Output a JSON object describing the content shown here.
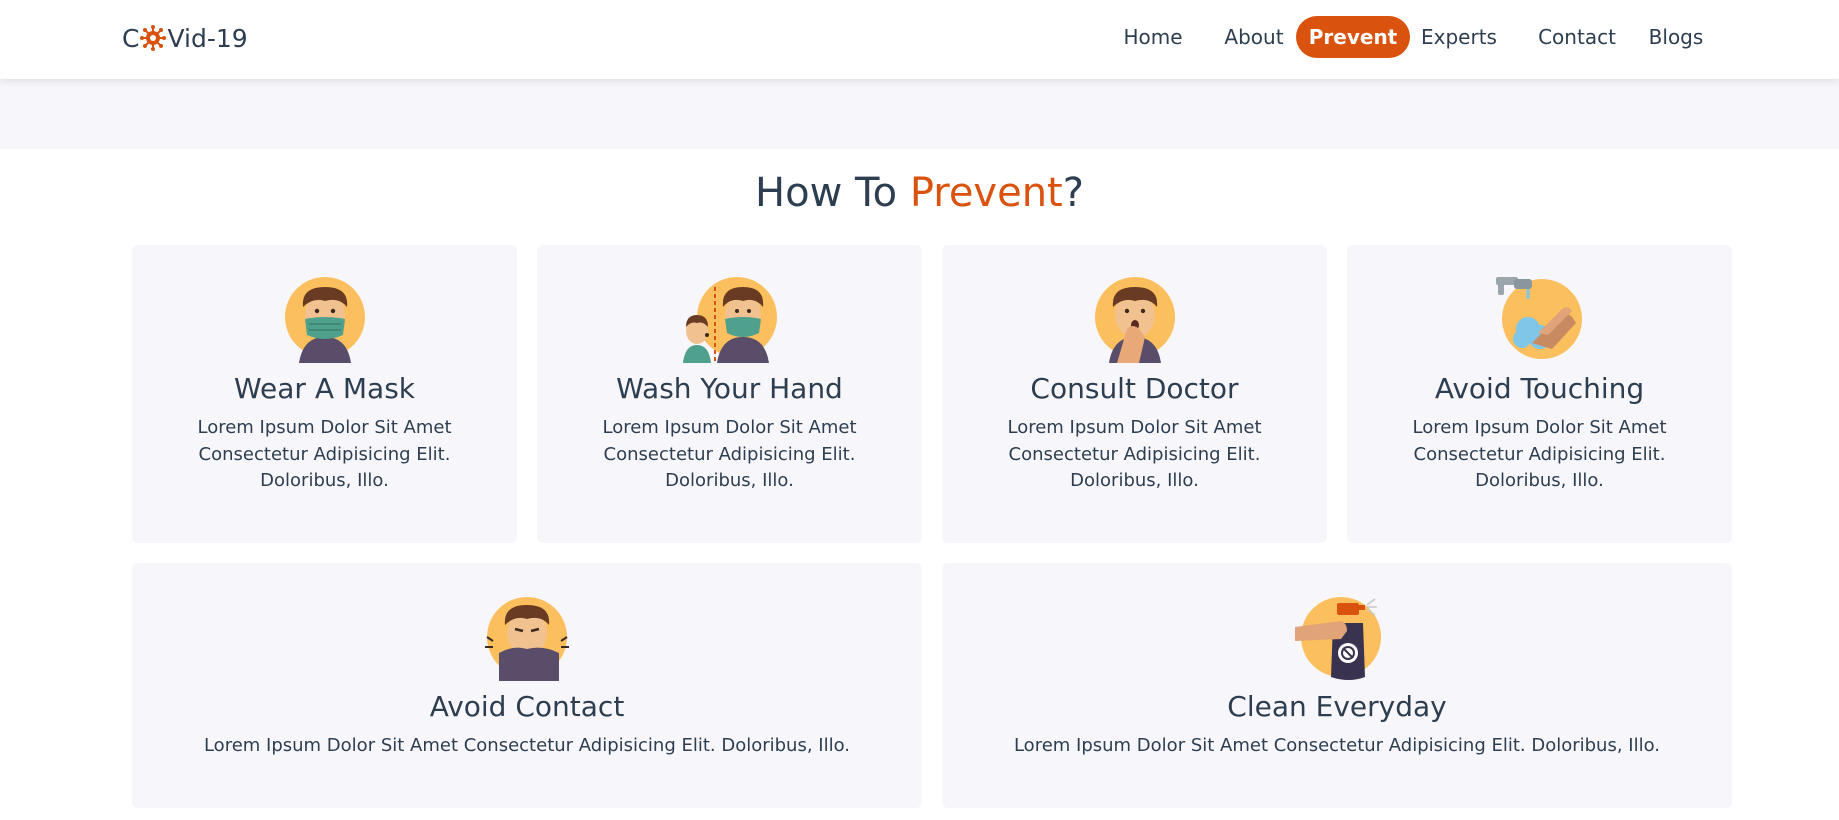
{
  "logo": {
    "prefix": "C",
    "suffix": "Vid-19",
    "icon": "virus-icon"
  },
  "nav": {
    "items": [
      {
        "label": "Home"
      },
      {
        "label": "About"
      },
      {
        "label": "Prevent",
        "active": true
      },
      {
        "label": "Experts"
      },
      {
        "label": "Contact"
      },
      {
        "label": "Blogs"
      }
    ]
  },
  "section": {
    "title_start": "How To ",
    "title_accent": "Prevent",
    "title_end": "?"
  },
  "colors": {
    "accent": "#d9530f",
    "text": "#2c3e50",
    "card_bg": "#f7f6fb",
    "icon_circle": "#fbbf5d"
  },
  "cards": [
    {
      "title": "Wear A Mask",
      "text": "Lorem Ipsum Dolor Sit Amet Consectetur Adipisicing Elit. Doloribus, Illo.",
      "icon": "mask-icon"
    },
    {
      "title": "Wash Your Hand",
      "text": "Lorem Ipsum Dolor Sit Amet Consectetur Adipisicing Elit. Doloribus, Illo.",
      "icon": "distance-icon"
    },
    {
      "title": "Consult Doctor",
      "text": "Lorem Ipsum Dolor Sit Amet Consectetur Adipisicing Elit. Doloribus, Illo.",
      "icon": "cough-icon"
    },
    {
      "title": "Avoid Touching",
      "text": "Lorem Ipsum Dolor Sit Amet Consectetur Adipisicing Elit. Doloribus, Illo.",
      "icon": "handwash-icon"
    },
    {
      "title": "Avoid Contact",
      "text": "Lorem Ipsum Dolor Sit Amet Consectetur Adipisicing Elit. Doloribus, Illo.",
      "icon": "sneeze-icon"
    },
    {
      "title": "Clean Everyday",
      "text": "Lorem Ipsum Dolor Sit Amet Consectetur Adipisicing Elit. Doloribus, Illo.",
      "icon": "spray-icon"
    }
  ]
}
